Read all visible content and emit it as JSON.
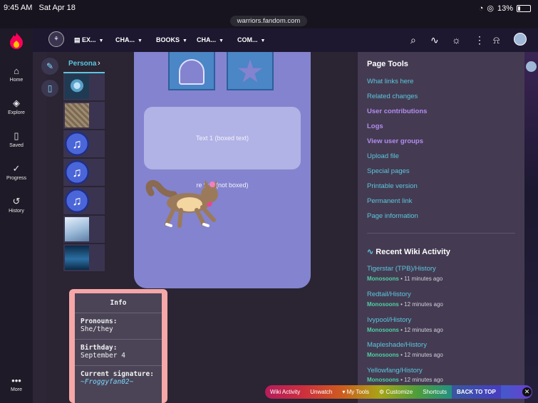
{
  "status": {
    "time": "9:45 AM",
    "date": "Sat Apr 18",
    "battery": "13%"
  },
  "url": "warriors.fandom.com",
  "rail": {
    "home": "Home",
    "explore": "Explore",
    "saved": "Saved",
    "progress": "Progress",
    "history": "History",
    "more": "More"
  },
  "nav": {
    "items": [
      "EX...",
      "CHA...",
      "BOOKS",
      "CHA...",
      "COM..."
    ]
  },
  "profile": {
    "tab": "Persona"
  },
  "panel": {
    "boxed": "Text 1 (boxed text)",
    "notboxed": "re text (not boxed)"
  },
  "info": {
    "title": "Info",
    "pronouns_label": "Pronouns:",
    "pronouns": "She/they",
    "birthday_label": "Birthday:",
    "birthday": "September 4",
    "signature_label": "Current signature:",
    "signature": "~Froggyfan02~"
  },
  "page_tools": {
    "title": "Page Tools",
    "links": [
      {
        "label": "What links here",
        "bold": false
      },
      {
        "label": "Related changes",
        "bold": false
      },
      {
        "label": "User contributions",
        "bold": true
      },
      {
        "label": "Logs",
        "bold": true
      },
      {
        "label": "View user groups",
        "bold": true
      },
      {
        "label": "Upload file",
        "bold": false
      },
      {
        "label": "Special pages",
        "bold": false
      },
      {
        "label": "Printable version",
        "bold": false
      },
      {
        "label": "Permanent link",
        "bold": false
      },
      {
        "label": "Page information",
        "bold": false
      }
    ]
  },
  "activity": {
    "title": "Recent Wiki Activity",
    "items": [
      {
        "page": "Tigerstar (TPB)/History",
        "user": "Monosoons",
        "time": "• 11 minutes ago"
      },
      {
        "page": "Redtail/History",
        "user": "Monosoons",
        "time": "• 12 minutes ago"
      },
      {
        "page": "Ivypool/History",
        "user": "Monosoons",
        "time": "• 12 minutes ago"
      },
      {
        "page": "Mapleshade/History",
        "user": "Monosoons",
        "time": "• 12 minutes ago"
      },
      {
        "page": "Yellowfang/History",
        "user": "Monosoons",
        "time": "• 12 minutes ago"
      }
    ]
  },
  "toolbar": {
    "wiki_activity": "Wiki Activity",
    "unwatch": "Unwatch",
    "my_tools": "My Tools",
    "customize": "Customize",
    "shortcuts": "Shortcuts",
    "back_to_top": "BACK TO TOP"
  }
}
